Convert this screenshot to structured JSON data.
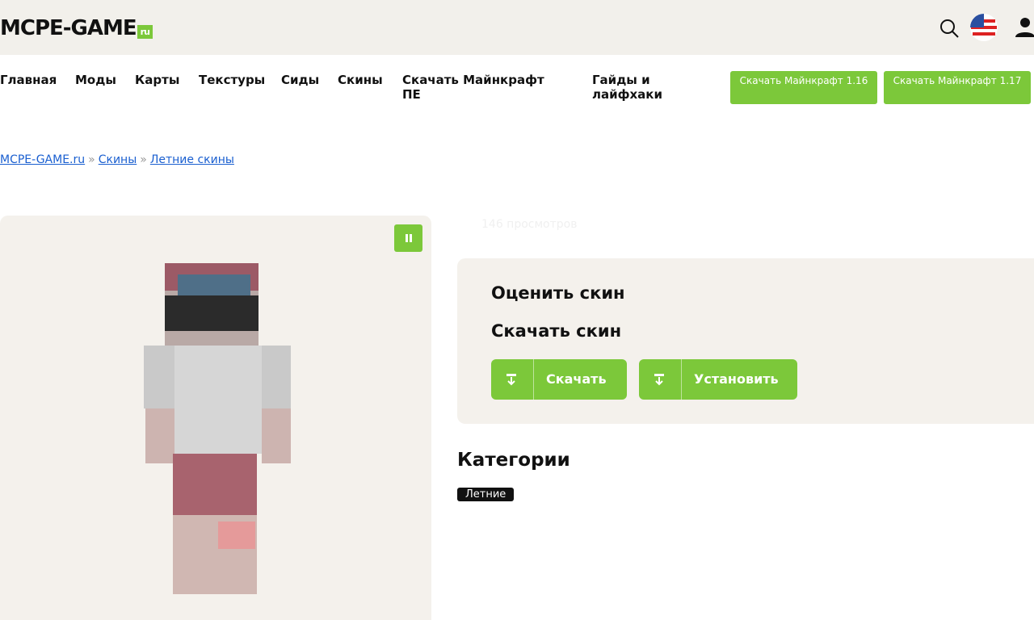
{
  "header": {
    "logo": "MCPE-GAME",
    "logo_tld": "ru"
  },
  "nav": {
    "items": [
      "Главная",
      "Моды",
      "Карты",
      "Текстуры",
      "Сиды",
      "Скины",
      "Скачать Майнкрафт ПЕ",
      "Гайды и лайфхаки"
    ]
  },
  "download_buttons": [
    {
      "label": "Скачать Майнкрафт 1.16"
    },
    {
      "label": "Скачать Майнкрафт 1.17"
    }
  ],
  "breadcrumb": [
    "MCPE-GAME.ru",
    "Скины",
    "Летние скины"
  ],
  "views": "146 просмотров",
  "panel": {
    "rate_title": "Оценить скин",
    "download_title": "Скачать скин",
    "download_button": "Скачать",
    "install_button": "Установить"
  },
  "categories": {
    "title": "Категории",
    "tags": [
      "Летние"
    ]
  },
  "colors": {
    "accent": "#7cc83a",
    "panel_bg": "#f4f1ec",
    "header_bg": "#f2f0eb",
    "link": "#1a5fd0"
  },
  "icons": [
    "search-icon",
    "us-flag-icon",
    "user-icon",
    "pause-icon",
    "download-icon"
  ]
}
